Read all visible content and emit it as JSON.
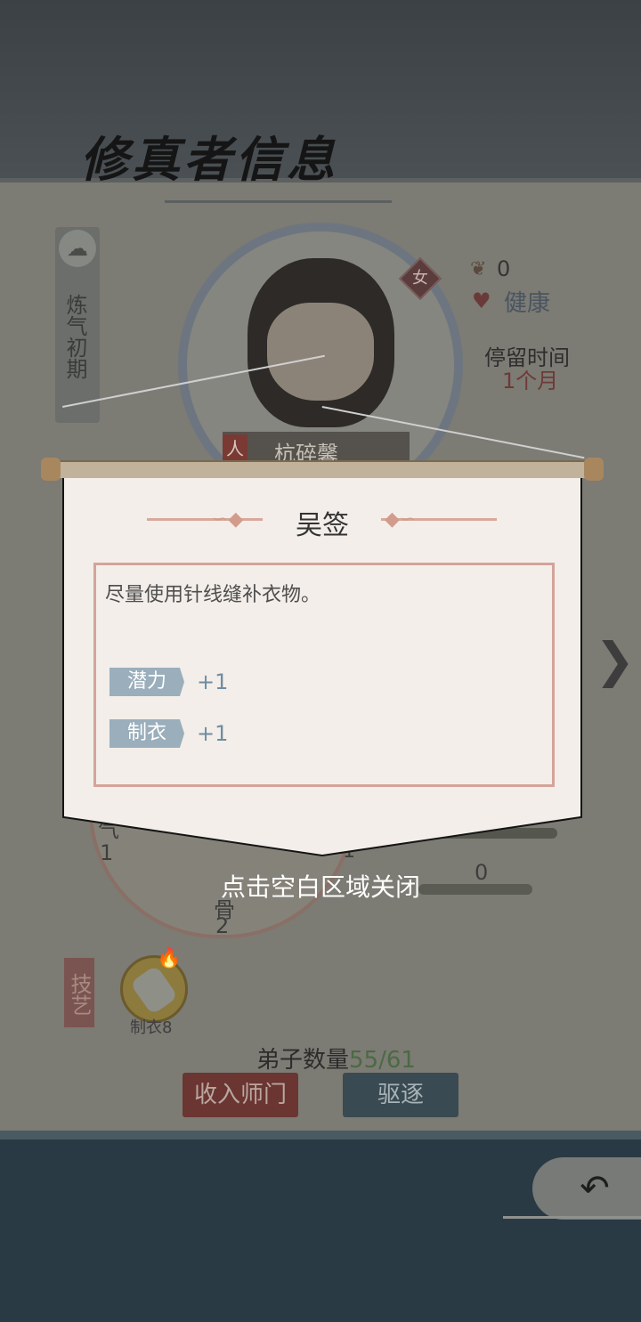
{
  "page_title": "修真者信息",
  "realm": "炼气初期",
  "character": {
    "name": "杭碎馨",
    "gender": "女",
    "tag": "人",
    "mood_value": "0",
    "health": "健康",
    "stay_label": "停留时间",
    "stay_value": "1个月"
  },
  "attributes": {
    "qi_label": "气",
    "qi_value": "1",
    "gu_label": "骨",
    "gu_value": "2",
    "mid_value": "1",
    "bar2_value": "0"
  },
  "skills": {
    "tag": "技艺",
    "item_label": "制衣8"
  },
  "disciples": {
    "label": "弟子数量",
    "count": "55/61"
  },
  "buttons": {
    "accept": "收入师门",
    "expel": "驱逐",
    "back": "↶"
  },
  "modal": {
    "title": "吴签",
    "description": "尽量使用针线缝补衣物。",
    "effects": [
      {
        "name": "潜力",
        "value": "+1"
      },
      {
        "name": "制衣",
        "value": "+1"
      }
    ],
    "close_hint": "点击空白区域关闭"
  },
  "colors": {
    "effect_tag": "#9aaebb",
    "effect_value": "#6f8ca0",
    "accept_button": "#6b3532",
    "expel_button": "#3a4a52"
  }
}
